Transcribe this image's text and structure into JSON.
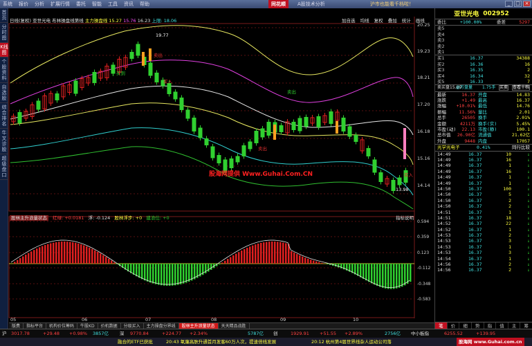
{
  "window": {
    "brand": "同花顺",
    "title": "A股技术分析",
    "tagline": "沪市也能看千档啦！",
    "menu": [
      "系统",
      "报价",
      "分析",
      "扩展行情",
      "委托",
      "智能",
      "工具",
      "资讯",
      "帮助"
    ],
    "btn_min": "_",
    "btn_max": "□",
    "btn_close": "×"
  },
  "sidebar": [
    {
      "label": "首页",
      "active": false
    },
    {
      "label": "分时图",
      "active": false
    },
    {
      "label": "K线图",
      "active": true
    },
    {
      "label": "个股资料",
      "active": false
    },
    {
      "label": "自选股",
      "active": false
    },
    {
      "label": "综合排名",
      "active": false
    },
    {
      "label": "牛叉诊股",
      "active": false
    },
    {
      "label": "超级盘口",
      "active": false
    }
  ],
  "chart_header": {
    "period": "日线(复权)",
    "stock": "亚世光电",
    "indicator": "布林操盘线第线",
    "bull": "主力操盘线",
    "v1_label": "15.27",
    "v2_label": "15.76",
    "v3_label": "16.23",
    "v4_label": "上限: 18.06",
    "buttons": [
      "加自选",
      "均线",
      "复权",
      "叠加",
      "统计",
      "画线"
    ]
  },
  "price_axis": [
    "20.25",
    "19.23",
    "18.21",
    "17.20",
    "16.18",
    "15.16",
    "14.14"
  ],
  "ind_axis": [
    "0.594",
    "0.359",
    "0.123",
    "-0.112",
    "-0.348",
    "-0.583"
  ],
  "date_axis": [
    "05",
    "06",
    "07",
    "08",
    "09",
    "10"
  ],
  "annotations": {
    "high": "19.77",
    "low": "13.98",
    "signals": [
      "卖出",
      "买到",
      "买入",
      "卖出",
      "卖出",
      "买入"
    ],
    "watermark": "股海网提供 Www.Guhai.Com.CN"
  },
  "indicator_header": {
    "name": "股林主升浪量状态",
    "l1": "红绿: +0.0181",
    "l2": "浮: -0.124",
    "l3": "股林浮步: +0",
    "l4": "建浪位: +0",
    "right": "指标说明"
  },
  "stock": {
    "name": "亚世光电",
    "code": "002952"
  },
  "order_book": {
    "ratio": {
      "label": "委比",
      "value": "+100.00%",
      "diff_label": "委差",
      "diff": "5297"
    },
    "sell": [
      {
        "label": "卖5",
        "price": "",
        "vol": ""
      },
      {
        "label": "卖4",
        "price": "",
        "vol": ""
      },
      {
        "label": "卖3",
        "price": "",
        "vol": ""
      },
      {
        "label": "卖2",
        "price": "",
        "vol": ""
      },
      {
        "label": "卖1",
        "price": "",
        "vol": ""
      }
    ],
    "buy": [
      {
        "label": "买1",
        "price": "16.37",
        "vol": "34388"
      },
      {
        "label": "买2",
        "price": "16.36",
        "vol": "16"
      },
      {
        "label": "买3",
        "price": "16.35",
        "vol": "2"
      },
      {
        "label": "买4",
        "price": "16.34",
        "vol": "32"
      },
      {
        "label": "买5",
        "price": "16.33",
        "vol": "7"
      }
    ]
  },
  "stats_header": {
    "left": "卖买盘15.89",
    "mid": "@万盘量",
    "right": "1.75手",
    "btn1": "买卖",
    "btn2": "查看十档"
  },
  "stats": [
    {
      "k1": "最新",
      "v1": "16.37",
      "k2": "开盘",
      "v2": "14.83"
    },
    {
      "k1": "涨跌",
      "v1": "+1.49",
      "k2": "最高",
      "v2": "16.37"
    },
    {
      "k1": "涨幅",
      "v1": "+10.01%",
      "k2": "最低",
      "v2": "14.76"
    },
    {
      "k1": "振幅",
      "v1": "11.56%",
      "k2": "量比",
      "v2": "2.01"
    },
    {
      "k1": "总手",
      "v1": "26505",
      "k2": "换手",
      "v2": "2.01%"
    },
    {
      "k1": "金额",
      "v1": "4211万",
      "k2": "换手(实)",
      "v2": "5.45%"
    },
    {
      "k1": "市盈(动)",
      "v1": "22.13",
      "k2": "市盈(静)",
      "v2": "100.1"
    },
    {
      "k1": "总市值",
      "v1": "26.90亿",
      "k2": "流通值",
      "v2": "21.62亿"
    },
    {
      "k1": "外盘",
      "v1": "9448",
      "k2": "内盘",
      "v2": "17057"
    }
  ],
  "sector": {
    "name": "光学光电子",
    "change": "0.41%",
    "btn": "同行比较"
  },
  "ticks": [
    {
      "t": "14:49",
      "p": "16.37",
      "v": "10"
    },
    {
      "t": "14:49",
      "p": "16.37",
      "v": "16"
    },
    {
      "t": "14:49",
      "p": "16.37",
      "v": "1"
    },
    {
      "t": "14:49",
      "p": "16.37",
      "v": "16"
    },
    {
      "t": "14:49",
      "p": "16.37",
      "v": "1"
    },
    {
      "t": "14:49",
      "p": "16.37",
      "v": "1"
    },
    {
      "t": "14:50",
      "p": "16.37",
      "v": "100"
    },
    {
      "t": "14:50",
      "p": "16.37",
      "v": "5"
    },
    {
      "t": "14:50",
      "p": "16.37",
      "v": "2"
    },
    {
      "t": "14:50",
      "p": "16.37",
      "v": "2"
    },
    {
      "t": "14:51",
      "p": "16.37",
      "v": "1"
    },
    {
      "t": "14:51",
      "p": "16.37",
      "v": "18"
    },
    {
      "t": "14:52",
      "p": "16.37",
      "v": "22"
    },
    {
      "t": "14:52",
      "p": "16.37",
      "v": "1"
    },
    {
      "t": "14:53",
      "p": "16.37",
      "v": "2"
    },
    {
      "t": "14:53",
      "p": "16.37",
      "v": "3"
    },
    {
      "t": "14:53",
      "p": "16.37",
      "v": "1"
    },
    {
      "t": "14:53",
      "p": "16.37",
      "v": "3"
    },
    {
      "t": "14:54",
      "p": "16.37",
      "v": "1"
    },
    {
      "t": "14:56",
      "p": "16.37",
      "v": "2"
    },
    {
      "t": "14:56",
      "p": "16.37",
      "v": "2"
    }
  ],
  "right_tabs": [
    "笔",
    "价",
    "细",
    "势",
    "指",
    "值",
    "主",
    "筹"
  ],
  "bottom_tabs": [
    "版费",
    "指标平台",
    "机构价位筹码",
    "牛股KD",
    "价机数据",
    "分级买入",
    "主力操盘分界线",
    "股林主升浪量状态",
    "天天精品战胜"
  ],
  "statusbar": {
    "sh_label": "沪",
    "sh": "3017.78",
    "sh_chg": "+29.48",
    "sh_pct": "+0.98%",
    "sh_amt": "3857亿",
    "sz_label": "深",
    "sz": "9770.84",
    "sz_chg": "+224.77",
    "sz_pct": "+2.34%",
    "sz_amt": "5787亿",
    "cy_label": "创",
    "cy": "1929.91",
    "cy_chg": "+51.55",
    "cy_pct": "+2.89%",
    "cy_amt": "2756亿",
    "zx_label": "中小板指",
    "zx": "6255.52",
    "zx_chg": "+139.95"
  },
  "ticker": {
    "logo": "股海网",
    "n1": "融合的ETF已获批",
    "n2": "20:43 氧廉高肤升通首月发客60万人次，提速倍线发展",
    "n3": "20:12 杭州第4届世界线杂人运动公司落",
    "site": "股海网 www.Guhai.com.cn"
  }
}
